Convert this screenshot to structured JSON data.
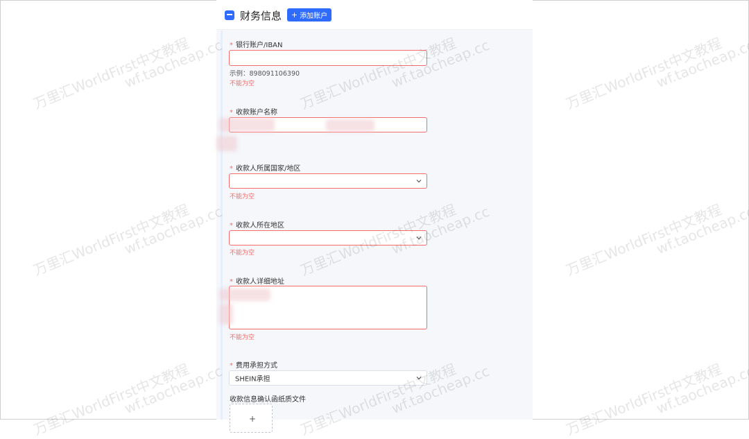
{
  "header": {
    "title": "财务信息",
    "add_button": "添加账户",
    "add_icon": "+"
  },
  "fields": {
    "iban": {
      "label": "银行账户/IBAN",
      "hint": "示例：898091106390",
      "error": "不能为空"
    },
    "account_name": {
      "label": "收款账户名称"
    },
    "country": {
      "label": "收款人所属国家/地区",
      "error": "不能为空"
    },
    "region": {
      "label": "收款人所在地区",
      "error": "不能为空"
    },
    "address": {
      "label": "收款人详细地址",
      "error": "不能为空"
    },
    "fee": {
      "label": "费用承担方式",
      "value": "SHEIN承担"
    },
    "file": {
      "label": "收款信息确认函纸质文件",
      "upload_icon": "+"
    }
  },
  "watermark": {
    "line1": "万里汇WorldFirst中文教程",
    "line2": "wf.taocheap.cc"
  },
  "colors": {
    "accent": "#2f6bff",
    "error": "#f56c6c"
  }
}
